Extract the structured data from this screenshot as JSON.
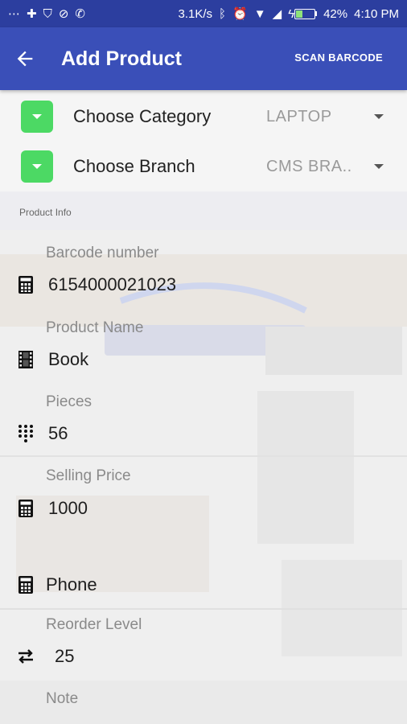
{
  "status_bar": {
    "left_icons": [
      "more-icon",
      "add-icon",
      "shield-icon",
      "link-icon",
      "whatsapp-icon"
    ],
    "net_speed": "3.1K/s",
    "battery_percent": "42%",
    "battery_level": 0.42,
    "time": "4:10 PM"
  },
  "app_bar": {
    "title": "Add Product",
    "scan_label": "SCAN BARCODE",
    "bg_color": "#3a4fb8"
  },
  "selectors": {
    "category": {
      "label": "Choose Category",
      "value": "LAPTOP"
    },
    "branch": {
      "label": "Choose Branch",
      "value": "CMS BRA.."
    }
  },
  "section": {
    "title": "Product Info"
  },
  "fields": {
    "barcode": {
      "label": "Barcode number",
      "value": "6154000021023",
      "icon": "calculator-icon"
    },
    "name": {
      "label": "Product Name",
      "value": "Book",
      "icon": "film-icon"
    },
    "pieces": {
      "label": "Pieces",
      "value": "56",
      "icon": "dialpad-icon"
    },
    "price": {
      "label": "Selling Price",
      "value": "1000",
      "icon": "calculator-icon"
    },
    "phone": {
      "placeholder": "Phone",
      "icon": "calculator-icon"
    },
    "reorder": {
      "label": "Reorder Level",
      "value": "25",
      "icon": "swap-arrows-icon"
    },
    "note": {
      "label": "Note"
    }
  },
  "colors": {
    "accent_green": "#4cd964",
    "primary": "#3a4fb8",
    "status": "#2c3e9f"
  }
}
